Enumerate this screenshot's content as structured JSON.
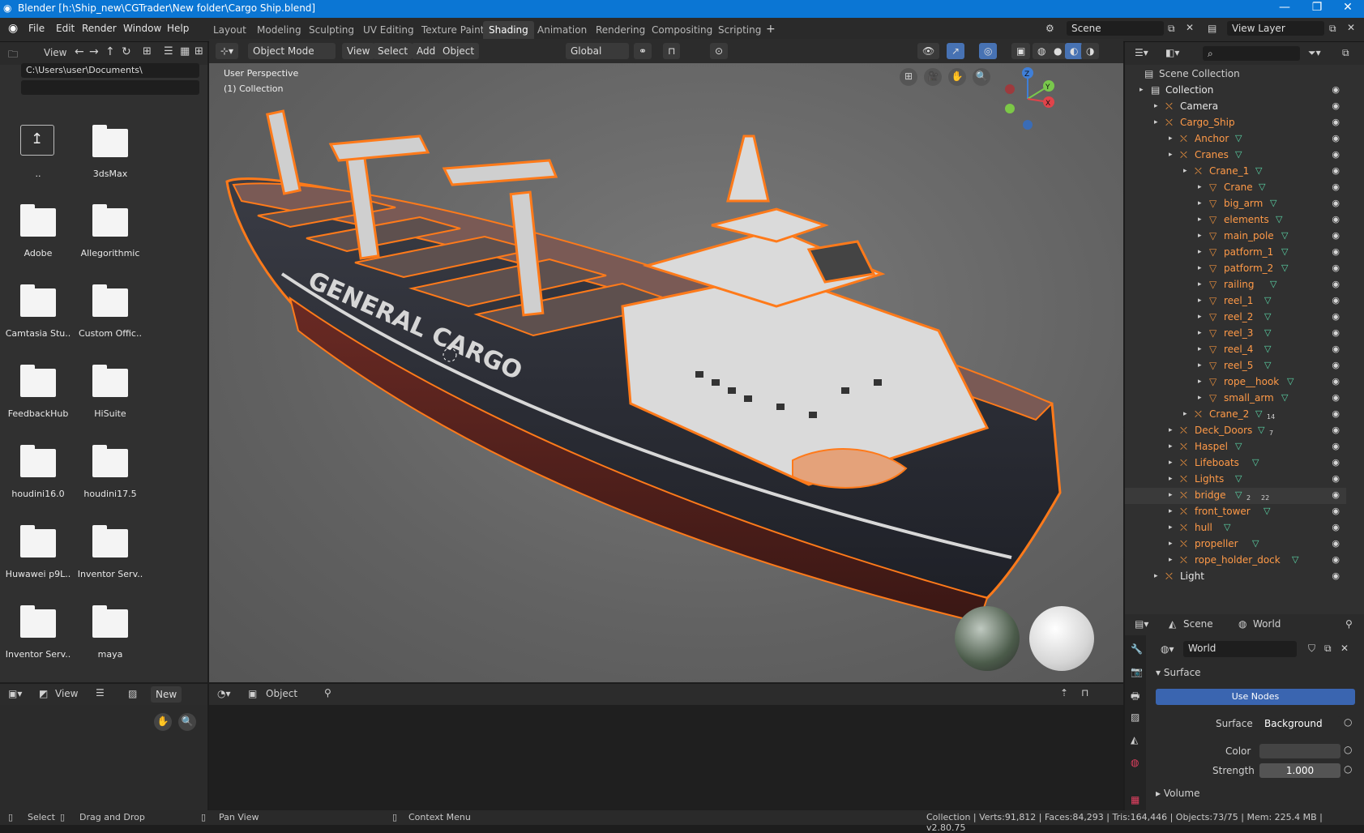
{
  "window": {
    "title": "Blender [h:\\Ship_new\\CGTrader\\New folder\\Cargo Ship.blend]",
    "controls": [
      "—",
      "❐",
      "✕"
    ]
  },
  "menus": [
    "File",
    "Edit",
    "Render",
    "Window",
    "Help"
  ],
  "workspace_tabs": [
    "Layout",
    "Modeling",
    "Sculpting",
    "UV Editing",
    "Texture Paint",
    "Shading",
    "Animation",
    "Rendering",
    "Compositing",
    "Scripting"
  ],
  "active_workspace": "Shading",
  "scene_field": "Scene",
  "view_layer_field": "View Layer",
  "file_browser": {
    "view_label": "View",
    "path": "C:\\Users\\user\\Documents\\",
    "items": [
      "..",
      "3dsMax",
      "Adobe",
      "Allegorithmic",
      "Camtasia Stu..",
      "Custom Offic..",
      "FeedbackHub",
      "HiSuite",
      "houdini16.0",
      "houdini17.5",
      "Huwawei p9L..",
      "Inventor Serv..",
      "Inventor Serv..",
      "maya"
    ]
  },
  "viewport": {
    "mode": "Object Mode",
    "menu": [
      "View",
      "Select",
      "Add",
      "Object"
    ],
    "transform": "Global",
    "overlay_text_1": "User Perspective",
    "overlay_text_2": "(1) Collection",
    "hull_text": "GENERAL CARGO",
    "axes": [
      "Z",
      "Y",
      "X"
    ]
  },
  "node_editor": {
    "left_header": {
      "view": "View",
      "new": "New"
    },
    "right_header": {
      "object": "Object"
    }
  },
  "outliner": {
    "root": "Scene Collection",
    "rows": [
      {
        "label": "Collection",
        "depth": 1
      },
      {
        "label": "Camera",
        "depth": 2
      },
      {
        "label": "Cargo_Ship",
        "depth": 2
      },
      {
        "label": "Anchor",
        "depth": 3
      },
      {
        "label": "Cranes",
        "depth": 3
      },
      {
        "label": "Crane_1",
        "depth": 4
      },
      {
        "label": "Crane",
        "depth": 5
      },
      {
        "label": "big_arm",
        "depth": 5
      },
      {
        "label": "elements",
        "depth": 5
      },
      {
        "label": "main_pole",
        "depth": 5
      },
      {
        "label": "patform_1",
        "depth": 5
      },
      {
        "label": "patform_2",
        "depth": 5
      },
      {
        "label": "railing",
        "depth": 5
      },
      {
        "label": "reel_1",
        "depth": 5
      },
      {
        "label": "reel_2",
        "depth": 5
      },
      {
        "label": "reel_3",
        "depth": 5
      },
      {
        "label": "reel_4",
        "depth": 5
      },
      {
        "label": "reel_5",
        "depth": 5
      },
      {
        "label": "rope__hook",
        "depth": 5
      },
      {
        "label": "small_arm",
        "depth": 5
      },
      {
        "label": "Crane_2",
        "depth": 4,
        "badge": "14"
      },
      {
        "label": "Deck_Doors",
        "depth": 3,
        "badge": "7"
      },
      {
        "label": "Haspel",
        "depth": 3
      },
      {
        "label": "Lifeboats",
        "depth": 3
      },
      {
        "label": "Lights",
        "depth": 3
      },
      {
        "label": "bridge",
        "depth": 3,
        "badge": "2",
        "badge2": "22"
      },
      {
        "label": "front_tower",
        "depth": 3
      },
      {
        "label": "hull",
        "depth": 3
      },
      {
        "label": "propeller",
        "depth": 3
      },
      {
        "label": "rope_holder_dock",
        "depth": 3
      },
      {
        "label": "Light",
        "depth": 2
      }
    ]
  },
  "properties": {
    "tabs": [
      "Scene",
      "World"
    ],
    "world_name": "World",
    "surface_header": "Surface",
    "use_nodes": "Use Nodes",
    "surface_label": "Surface",
    "surface_value": "Background",
    "color_label": "Color",
    "strength_label": "Strength",
    "strength_value": "1.000",
    "volume_header": "Volume"
  },
  "status_bar": {
    "select": "Select",
    "drag": "Drag and Drop",
    "pan": "Pan View",
    "context": "Context Menu",
    "stats": "Collection | Verts:91,812 | Faces:84,293 | Tris:164,446 | Objects:73/75 | Mem: 225.4 MB | v2.80.75"
  },
  "colors": {
    "accent": "#0b76d4",
    "active_tab": "#3d3d3d",
    "outline": "#ff7a1a",
    "use_nodes": "#3a65b0"
  }
}
